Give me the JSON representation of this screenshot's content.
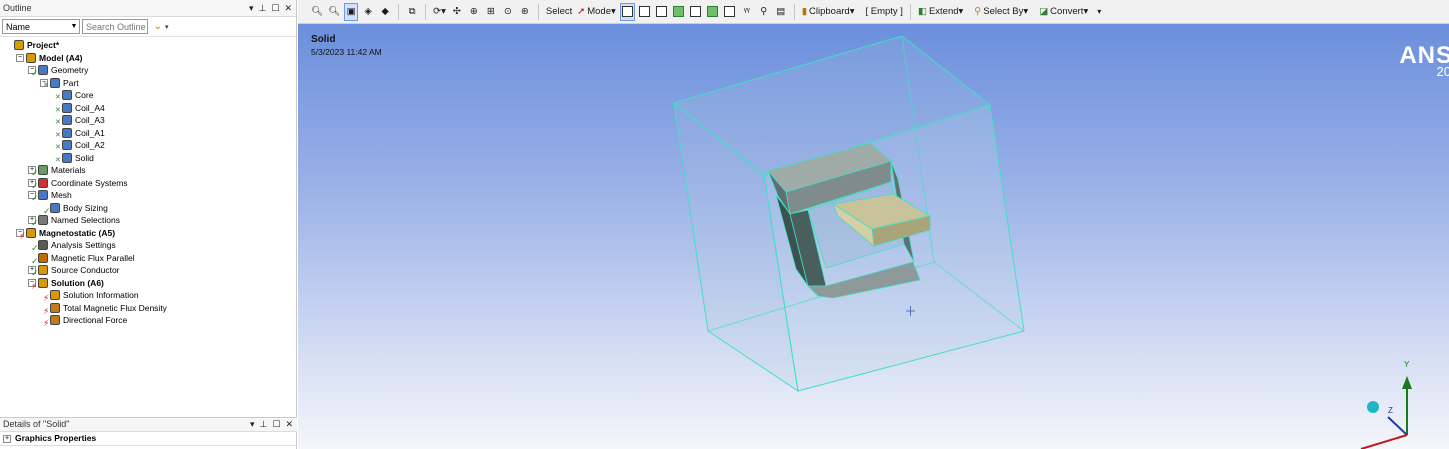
{
  "outline": {
    "title": "Outline",
    "controls": [
      "▾",
      "⊥",
      "☐",
      "✕"
    ],
    "filter": {
      "name_label": "Name",
      "search_placeholder": "Search Outline",
      "dropdown_icon": "chevron-down-icon"
    },
    "tree": [
      {
        "label": "Project*",
        "bold": true,
        "icon": "project-icon"
      },
      {
        "label": "Model (A4)",
        "bold": true,
        "icon": "model-icon",
        "expand": "−"
      },
      {
        "label": "Geometry",
        "icon": "geometry-icon",
        "expand": "−",
        "status": "check"
      },
      {
        "label": "Part",
        "icon": "part-icon",
        "expand": "−",
        "status": "x"
      },
      {
        "label": "Core",
        "icon": "body-icon",
        "status": "x"
      },
      {
        "label": "Coil_A4",
        "icon": "body-icon",
        "status": "x"
      },
      {
        "label": "Coil_A3",
        "icon": "body-icon",
        "status": "x"
      },
      {
        "label": "Coil_A1",
        "icon": "body-icon",
        "status": "x"
      },
      {
        "label": "Coil_A2",
        "icon": "body-icon",
        "status": "x"
      },
      {
        "label": "Solid",
        "icon": "body-icon",
        "status": "x"
      },
      {
        "label": "Materials",
        "icon": "materials-icon",
        "expand": "+",
        "status": "check"
      },
      {
        "label": "Coordinate Systems",
        "icon": "coordinate-icon",
        "expand": "+",
        "status": "check"
      },
      {
        "label": "Mesh",
        "icon": "mesh-icon",
        "expand": "−",
        "status": "check"
      },
      {
        "label": "Body Sizing",
        "icon": "sizing-icon",
        "status": "check"
      },
      {
        "label": "Named Selections",
        "icon": "named-sel-icon",
        "expand": "+",
        "status": "check"
      },
      {
        "label": "Magnetostatic (A5)",
        "bold": true,
        "icon": "analysis-icon",
        "expand": "−",
        "status": "lightning"
      },
      {
        "label": "Analysis Settings",
        "icon": "settings-icon",
        "status": "check"
      },
      {
        "label": "Magnetic Flux Parallel",
        "icon": "flux-icon",
        "status": "check"
      },
      {
        "label": "Source Conductor",
        "icon": "conductor-icon",
        "expand": "+",
        "status": "check"
      },
      {
        "label": "Solution (A6)",
        "bold": true,
        "icon": "solution-icon",
        "expand": "−",
        "status": "lightning"
      },
      {
        "label": "Solution Information",
        "icon": "info-icon",
        "status": "lightning"
      },
      {
        "label": "Total Magnetic Flux Density",
        "icon": "result-icon",
        "status": "lightning"
      },
      {
        "label": "Directional Force",
        "icon": "result-icon",
        "status": "lightning"
      }
    ]
  },
  "details": {
    "title": "Details of \"Solid\"",
    "controls": [
      "▾",
      "⊥",
      "☐",
      "✕"
    ],
    "rows": [
      {
        "label": "Graphics Properties",
        "expand": "+"
      }
    ]
  },
  "toolbar": {
    "select_label": "Select",
    "mode_label": "Mode",
    "clipboard_label": "Clipboard",
    "empty_label": "[ Empty ]",
    "extend_label": "Extend",
    "select_by_label": "Select By",
    "convert_label": "Convert"
  },
  "viewport": {
    "title": "Solid",
    "date": "5/3/2023 11:42 AM",
    "logo_text": "ANS",
    "logo_sub": "20",
    "axis_y": "Y",
    "axis_z": "Z"
  },
  "colors": {
    "viewport_top": "#6b8fdd",
    "viewport_bottom": "#f4f6fb",
    "box_edge": "#3fe0c4",
    "core_face": "#8a9a9c",
    "coil_face": "#b9b58a",
    "check": "#2d8a2d",
    "lightning": "#d11111"
  }
}
